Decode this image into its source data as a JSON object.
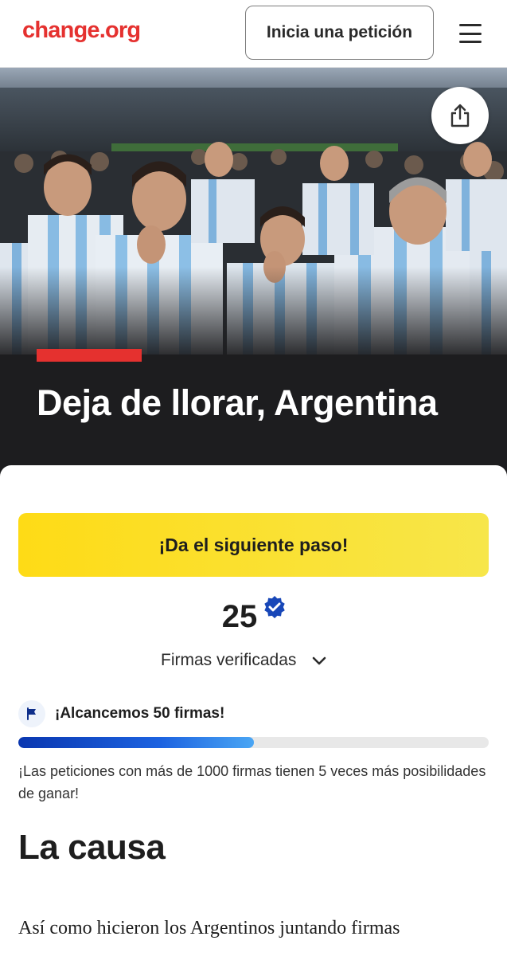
{
  "header": {
    "logo_text": "change.org",
    "start_petition_label": "Inicia una petición",
    "menu_icon": "hamburger-menu-icon"
  },
  "hero": {
    "photo_description_icon": "crowd-photo",
    "share_icon": "share-icon",
    "title": "Deja de llorar, Argentina"
  },
  "cta": {
    "label": "¡Da el siguiente paso!"
  },
  "signatures": {
    "count": "25",
    "verified_icon": "verified-badge-icon",
    "label": "Firmas verificadas",
    "expand_icon": "chevron-down-icon"
  },
  "goal": {
    "flag_icon": "flag-icon",
    "text": "¡Alcancemos 50 firmas!",
    "progress_fraction": 0.5,
    "hint": "¡Las peticiones con más de 1000 firmas tienen 5 veces más posibilidades de ganar!"
  },
  "cause": {
    "title": "La causa",
    "body_first_line": "Así como hicieron los Argentinos juntando firmas"
  },
  "colors": {
    "brand_red": "#e5312f",
    "cta_yellow": "#fedb16",
    "progress_blue": "#1c62e0",
    "hero_dark": "#1d1d1f"
  }
}
